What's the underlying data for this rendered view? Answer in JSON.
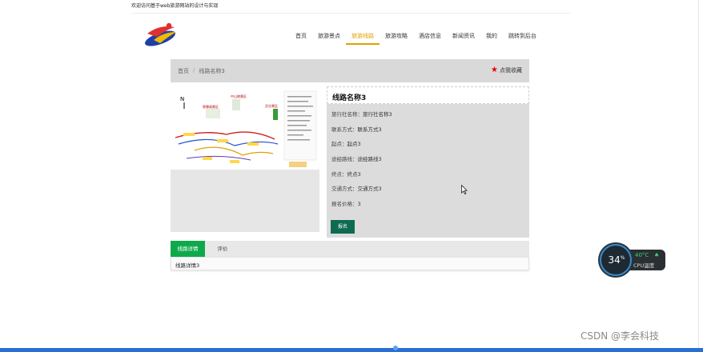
{
  "welcome_text": "欢迎访问基于web旅游网站的设计与实现",
  "nav": {
    "items": [
      "首页",
      "旅游景点",
      "旅游线路",
      "旅游攻略",
      "酒店信息",
      "新闻资讯",
      "我的",
      "跳转到后台"
    ],
    "active_index": 2
  },
  "breadcrumb": {
    "home": "首页",
    "separator": "/",
    "current": "线路名称3"
  },
  "favorite": {
    "label": "点我收藏",
    "icon": "star-icon"
  },
  "route": {
    "title": "线路名称3",
    "rows": [
      {
        "key": "旅行社名称：",
        "value": "旅行社名称3"
      },
      {
        "key": "联系方式：",
        "value": "联系方式3"
      },
      {
        "key": "起点：",
        "value": "起点3"
      },
      {
        "key": "途经路线：",
        "value": "途经路线3"
      },
      {
        "key": "终点：",
        "value": "终点3"
      },
      {
        "key": "交通方式：",
        "value": "交通方式3"
      },
      {
        "key": "报名价格：",
        "value": "3"
      }
    ],
    "signup_label": "报名"
  },
  "tabs": {
    "items": [
      "线路详情",
      "评价"
    ],
    "active_index": 0,
    "content": "线路详情3"
  },
  "map": {
    "labels": [
      "鄂豫阁景区",
      "中山陵景区",
      "灵谷景区"
    ],
    "north": "N"
  },
  "widget": {
    "percent": "34",
    "percent_sign": "%",
    "temp": "40°C",
    "label": "CPU温度"
  },
  "watermark": "CSDN @李会科技",
  "colors": {
    "accent": "#e0a000",
    "tab_active": "#0ea94b",
    "button": "#0e6b52",
    "star": "#ee0000"
  }
}
